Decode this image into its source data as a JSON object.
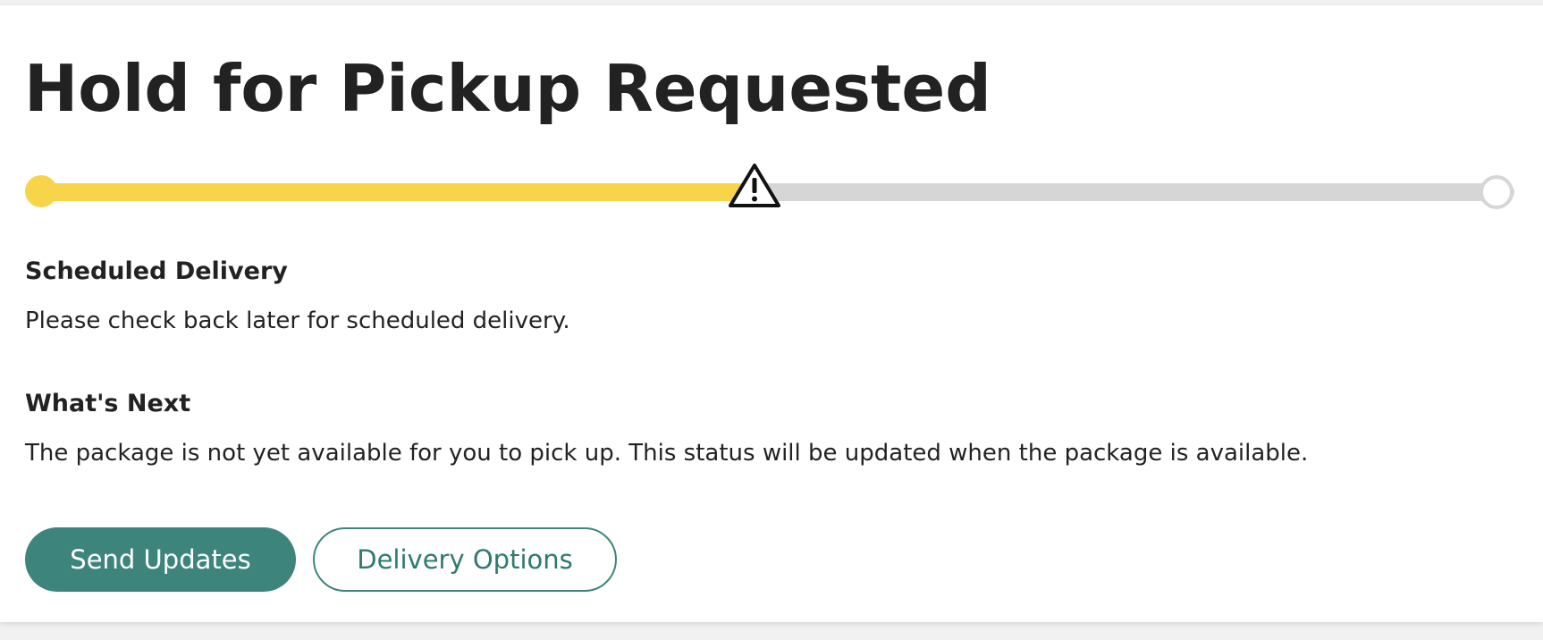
{
  "status": {
    "title": "Hold for Pickup Requested",
    "progress_fraction": 0.5
  },
  "progress": {
    "start_marker_color": "#f7d44a",
    "fill_color": "#f7d44a",
    "track_color": "#d6d6d6",
    "current_marker_icon": "warning-triangle-icon"
  },
  "scheduled_delivery": {
    "heading": "Scheduled Delivery",
    "text": "Please check back later for scheduled delivery."
  },
  "whats_next": {
    "heading": "What's Next",
    "text": "The package is not yet available for you to pick up. This status will be updated when the package is available."
  },
  "actions": {
    "send_updates_label": "Send Updates",
    "delivery_options_label": "Delivery Options",
    "accent_color": "#3d857c"
  }
}
